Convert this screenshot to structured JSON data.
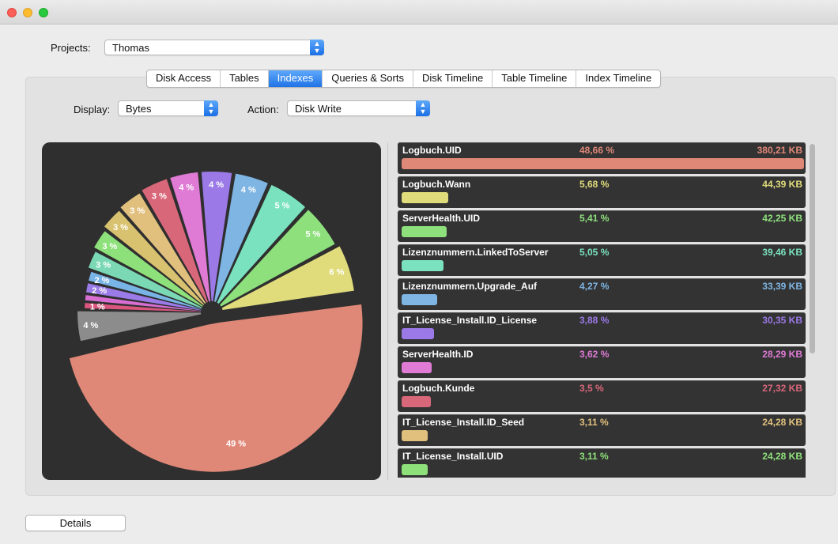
{
  "window": {
    "controls": [
      "close",
      "minimize",
      "zoom"
    ]
  },
  "projects": {
    "label": "Projects:",
    "value": "Thomas"
  },
  "tabs": [
    {
      "label": "Disk Access",
      "active": false
    },
    {
      "label": "Tables",
      "active": false
    },
    {
      "label": "Indexes",
      "active": true
    },
    {
      "label": "Queries & Sorts",
      "active": false
    },
    {
      "label": "Disk Timeline",
      "active": false
    },
    {
      "label": "Table Timeline",
      "active": false
    },
    {
      "label": "Index Timeline",
      "active": false
    }
  ],
  "display": {
    "label": "Display:",
    "value": "Bytes"
  },
  "action": {
    "label": "Action:",
    "value": "Disk Write"
  },
  "pie": {
    "slices": [
      {
        "label": "49 %",
        "value": 48.66,
        "color": "#e08878"
      },
      {
        "label": "4 %",
        "value": 4.0,
        "color": "#8c8c8c"
      },
      {
        "label": "1 %",
        "value": 1.0,
        "color": "#d9567e"
      },
      {
        "label": "",
        "value": 1.0,
        "color": "#d86ed2"
      },
      {
        "label": "2 %",
        "value": 1.5,
        "color": "#9b7be8"
      },
      {
        "label": "2 %",
        "value": 1.5,
        "color": "#79b4e6"
      },
      {
        "label": "3 %",
        "value": 2.5,
        "color": "#7ad9b4"
      },
      {
        "label": "3 %",
        "value": 2.7,
        "color": "#8ee07a"
      },
      {
        "label": "3 %",
        "value": 2.9,
        "color": "#d8c270"
      },
      {
        "label": "3 %",
        "value": 3.11,
        "color": "#e1c07e"
      },
      {
        "label": "3 %",
        "value": 3.5,
        "color": "#d9677a"
      },
      {
        "label": "4 %",
        "value": 3.62,
        "color": "#df7ad5"
      },
      {
        "label": "4 %",
        "value": 3.88,
        "color": "#9b79e6"
      },
      {
        "label": "4 %",
        "value": 4.27,
        "color": "#7eb5e3"
      },
      {
        "label": "5 %",
        "value": 5.05,
        "color": "#7ae2bf"
      },
      {
        "label": "5 %",
        "value": 5.41,
        "color": "#8ee07d"
      },
      {
        "label": "6 %",
        "value": 5.68,
        "color": "#e0dc7c"
      }
    ]
  },
  "indexes": [
    {
      "name": "Logbuch.UID",
      "percent": "48,66 %",
      "size": "380,21 KB",
      "fraction": 1.0,
      "color": "#e08878"
    },
    {
      "name": "Logbuch.Wann",
      "percent": "5,68 %",
      "size": "44,39 KB",
      "fraction": 0.1167,
      "color": "#e0dc7c"
    },
    {
      "name": "ServerHealth.UID",
      "percent": "5,41 %",
      "size": "42,25 KB",
      "fraction": 0.1112,
      "color": "#8ee07d"
    },
    {
      "name": "Lizenznummern.LinkedToServer",
      "percent": "5,05 %",
      "size": "39,46 KB",
      "fraction": 0.1038,
      "color": "#7ae2bf"
    },
    {
      "name": "Lizenznummern.Upgrade_Auf",
      "percent": "4,27 %",
      "size": "33,39 KB",
      "fraction": 0.0878,
      "color": "#7eb5e3"
    },
    {
      "name": "IT_License_Install.ID_License",
      "percent": "3,88 %",
      "size": "30,35 KB",
      "fraction": 0.0797,
      "color": "#9b79e6"
    },
    {
      "name": "ServerHealth.ID",
      "percent": "3,62 %",
      "size": "28,29 KB",
      "fraction": 0.0744,
      "color": "#df7ad5"
    },
    {
      "name": "Logbuch.Kunde",
      "percent": "3,5 %",
      "size": "27,32 KB",
      "fraction": 0.0719,
      "color": "#d9677a"
    },
    {
      "name": "IT_License_Install.ID_Seed",
      "percent": "3,11 %",
      "size": "24,28 KB",
      "fraction": 0.0639,
      "color": "#e1c07e"
    },
    {
      "name": "IT_License_Install.UID",
      "percent": "3,11 %",
      "size": "24,28 KB",
      "fraction": 0.0639,
      "color": "#8ee07a"
    }
  ],
  "details_button": "Details"
}
